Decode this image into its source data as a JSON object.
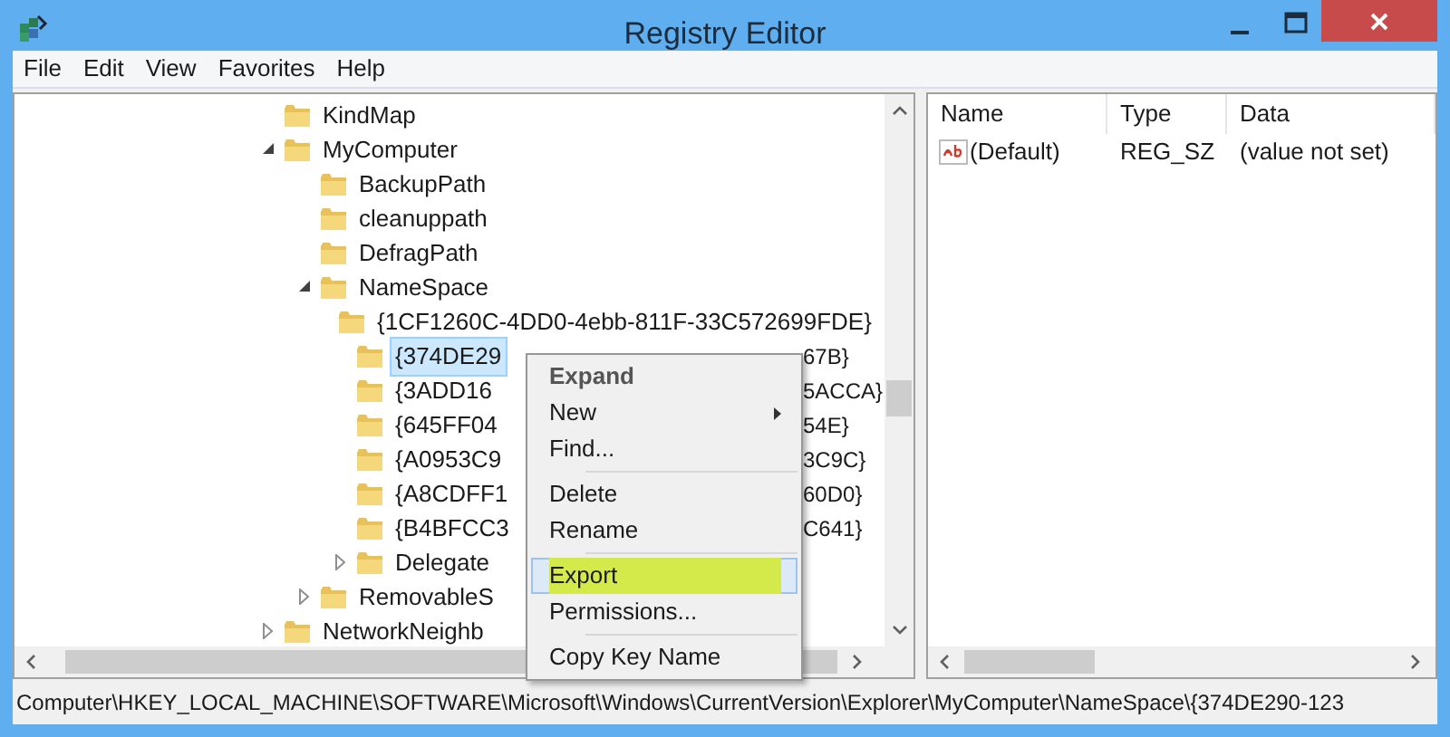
{
  "window": {
    "title": "Registry Editor"
  },
  "menu_bar": [
    "File",
    "Edit",
    "View",
    "Favorites",
    "Help"
  ],
  "tree": [
    {
      "label": "KindMap",
      "selected": false
    },
    {
      "label": "MyComputer",
      "expanded": true,
      "selected": false,
      "children": [
        {
          "label": "BackupPath",
          "selected": false
        },
        {
          "label": "cleanuppath",
          "selected": false
        },
        {
          "label": "DefragPath",
          "selected": false
        },
        {
          "label": "NameSpace",
          "expanded": true,
          "selected": false,
          "children": [
            {
              "label": "{1CF1260C-4DD0-4ebb-811F-33C572699FDE}",
              "selected": false
            },
            {
              "label": "{374DE29",
              "label_end": "67B}",
              "selected": true
            },
            {
              "label": "{3ADD16",
              "label_end": "5ACCA}",
              "selected": false
            },
            {
              "label": "{645FF04",
              "label_end": "54E}",
              "selected": false
            },
            {
              "label": "{A0953C9",
              "label_end": "3C9C}",
              "selected": false
            },
            {
              "label": "{A8CDFF1",
              "label_end": "60D0}",
              "selected": false
            },
            {
              "label": "{B4BFCC3",
              "label_end": "C641}",
              "selected": false
            },
            {
              "label": "Delegate",
              "expanded": false,
              "selected": false
            }
          ]
        },
        {
          "label": "RemovableS",
          "expanded": false,
          "selected": false
        }
      ]
    },
    {
      "label": "NetworkNeighb",
      "expanded": false,
      "selected": false
    }
  ],
  "values": {
    "columns": [
      "Name",
      "Type",
      "Data"
    ],
    "rows": [
      {
        "name": "(Default)",
        "type": "REG_SZ",
        "data": "(value not set)"
      }
    ]
  },
  "context_menu": {
    "groups": [
      [
        {
          "label": "Expand",
          "default": true,
          "has_submenu": false,
          "selected": false
        },
        {
          "label": "New",
          "default": false,
          "has_submenu": true,
          "selected": false
        },
        {
          "label": "Find...",
          "default": false,
          "has_submenu": false,
          "selected": false
        }
      ],
      [
        {
          "label": "Delete",
          "default": false,
          "has_submenu": false,
          "selected": false
        },
        {
          "label": "Rename",
          "default": false,
          "has_submenu": false,
          "selected": false
        }
      ],
      [
        {
          "label": "Export",
          "default": false,
          "has_submenu": false,
          "selected": true
        },
        {
          "label": "Permissions...",
          "default": false,
          "has_submenu": false,
          "selected": false
        }
      ],
      [
        {
          "label": "Copy Key Name",
          "default": false,
          "has_submenu": false,
          "selected": false
        }
      ]
    ]
  },
  "status_bar": "Computer\\HKEY_LOCAL_MACHINE\\SOFTWARE\\Microsoft\\Windows\\CurrentVersion\\Explorer\\MyComputer\\NameSpace\\{374DE290-123"
}
